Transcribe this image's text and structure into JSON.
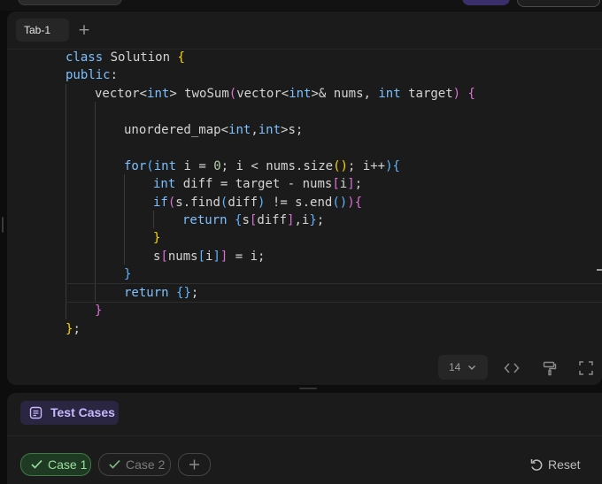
{
  "editor": {
    "tab_label": "Tab-1",
    "font_size": "14",
    "code_lines": [
      "class Solution {",
      "public:",
      "vector<int> twoSum(vector<int>& nums, int target) {",
      "",
      "unordered_map<int,int>s;",
      "",
      "for(int i = 0; i < nums.size(); i++){",
      "int diff = target - nums[i];",
      "if(s.find(diff) != s.end()){",
      "return {s[diff],i};",
      "}",
      "s[nums[i]] = i;",
      "}",
      "return {};",
      "}",
      "};"
    ]
  },
  "testcases": {
    "tab_label": "Test Cases",
    "cases": [
      {
        "label": "Case 1",
        "active": true
      },
      {
        "label": "Case 2",
        "active": false
      }
    ],
    "reset_label": "Reset"
  },
  "colors": {
    "accent_purple": "#c8b8ff",
    "case_active_green": "#9be09f",
    "keyword_blue": "#7cc0ff",
    "bracket_yellow": "#ffd700"
  },
  "icons": [
    "plus-icon",
    "chevron-down-icon",
    "code-icon",
    "format-roller-icon",
    "fullscreen-icon",
    "test-cases-icon",
    "check-icon",
    "reset-icon"
  ]
}
